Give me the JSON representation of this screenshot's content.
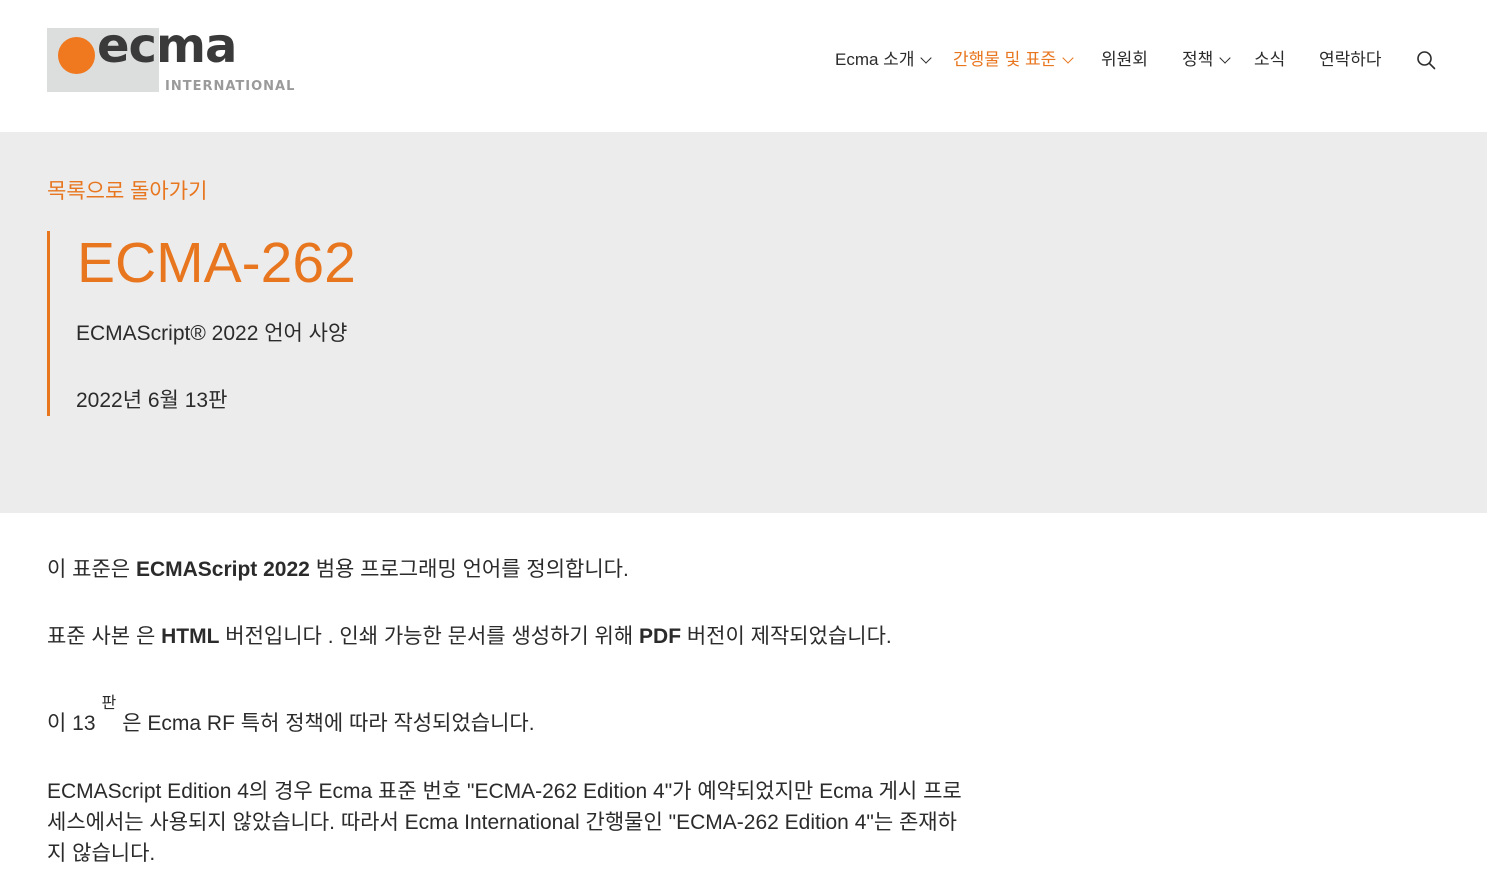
{
  "header": {
    "logo": {
      "word": "ecma",
      "sub": "INTERNATIONAL"
    },
    "nav": [
      {
        "label": "Ecma 소개",
        "dropdown": true
      },
      {
        "label": "간행물 및 표준",
        "dropdown": true,
        "active": true
      },
      {
        "label": "위원회",
        "dropdown": false
      },
      {
        "label": "정책",
        "dropdown": true
      },
      {
        "label": "소식",
        "dropdown": false
      },
      {
        "label": "연락하다",
        "dropdown": false
      }
    ],
    "search_icon": "search-icon"
  },
  "hero": {
    "back_link": "목록으로 돌아가기",
    "title": "ECMA-262",
    "subtitle": "ECMAScript® 2022 언어 사양",
    "edition": "2022년 6월 13판"
  },
  "content": {
    "p1": {
      "pre": "이 표준은 ",
      "bold": "ECMAScript 2022",
      "post": " 범용 프로그래밍 언어를 정의합니다."
    },
    "p2": {
      "pre": "표준 사본 은 ",
      "bold1": "HTML",
      "mid": " 버전입니다 . 인쇄 가능한 문서를 생성하기 위해 ",
      "bold2": "PDF",
      "post": " 버전이 제작되었습니다."
    },
    "p3": {
      "pre": "이 13",
      "sup": "판",
      "post": "은 Ecma RF 특허 정책에 따라 작성되었습니다."
    },
    "p4": "ECMAScript Edition 4의 경우 Ecma 표준 번호 \"ECMA-262 Edition 4\"가 예약되었지만 Ecma 게시 프로세스에서는 사용되지 않았습니다. 따라서 Ecma International 간행물인 \"ECMA-262 Edition 4\"는 존재하지 않습니다."
  },
  "colors": {
    "accent": "#e8761f",
    "hero_bg": "#ececec",
    "logo_box": "#dcdedd"
  }
}
